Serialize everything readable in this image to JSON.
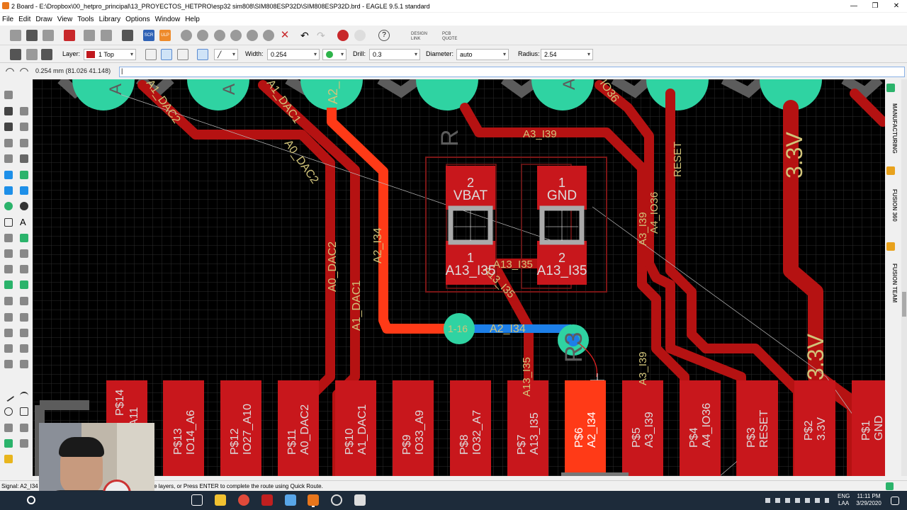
{
  "window": {
    "title": "2 Board - E:\\Dropbox\\00_hetpro_principal\\13_PROYECTOS_HETPRO\\esp32 sim808\\SIM808ESP32D\\SIM808ESP32D.brd - EAGLE 9.5.1 standard"
  },
  "menu": [
    "File",
    "Edit",
    "Draw",
    "View",
    "Tools",
    "Library",
    "Options",
    "Window",
    "Help"
  ],
  "toolbar": {
    "design_link": "DESIGN\nLINK",
    "pcb_quote": "PCB\nQUOTE",
    "scr": "SCR",
    "ulp": "ULP"
  },
  "params": {
    "layer_label": "Layer:",
    "layer_value": "1 Top",
    "layer_color": "#c0181d",
    "width_label": "Width:",
    "width_value": "0.254",
    "drill_label": "Drill:",
    "drill_value": "0.3",
    "diameter_label": "Diameter:",
    "diameter_value": "auto",
    "radius_label": "Radius:",
    "radius_value": "2.54"
  },
  "command": {
    "coords": "0.254 mm (81.026 41.148)",
    "value": "|"
  },
  "status": "Signal: A2_I34 ...ble-click ends wire), Press SPACE to change layers, or Press ENTER to complete the route using Quick Route.",
  "side_tabs": [
    "MANUFACTURING",
    "FUSION 360",
    "FUSION TEAM"
  ],
  "tray": {
    "lang1": "ENG",
    "lang2": "LAA",
    "time": "11:11 PM",
    "date": "3/29/2020"
  },
  "colors": {
    "copper": "#b51212",
    "pad": "#c8171c",
    "highlight": "#ff3a17",
    "route_blue": "#1d7fe8",
    "via": "#2fd3a2",
    "grid": "#2c2c2c",
    "text": "#d1c47a"
  },
  "board": {
    "top_labels": [
      "A",
      "A",
      "A2_",
      "A",
      "A1_DAC2",
      "A1_DAC1",
      "A0_DAC2",
      "IO36",
      "R",
      "A3_I39"
    ],
    "net_labels": [
      "A0_DAC2",
      "A1_DAC1",
      "A2_I34",
      "A13_I35",
      "A13_I35",
      "A3_I39",
      "A4_IO36",
      "RESET",
      "3.3V",
      "3.3V",
      "A3_I39",
      "A2_I34",
      "1-16",
      "A13_I35"
    ],
    "smd_labels": [
      "2",
      "VBAT",
      "1",
      "A13_I35",
      "1",
      "GND",
      "2",
      "A13_I35"
    ],
    "pads": [
      {
        "pin": "P$14",
        "net": "A11"
      },
      {
        "pin": "P$13",
        "net": "IO14_A6"
      },
      {
        "pin": "P$12",
        "net": "IO27_A10"
      },
      {
        "pin": "P$11",
        "net": "A0_DAC2"
      },
      {
        "pin": "P$10",
        "net": "A1_DAC1"
      },
      {
        "pin": "P$9",
        "net": "IO33_A9"
      },
      {
        "pin": "P$8",
        "net": "IO32_A7"
      },
      {
        "pin": "P$7",
        "net": "A13_I35"
      },
      {
        "pin": "P$6",
        "net": "A2_I34"
      },
      {
        "pin": "P$5",
        "net": "A3_I39"
      },
      {
        "pin": "P$4",
        "net": "A4_IO36"
      },
      {
        "pin": "P$3",
        "net": "RESET"
      },
      {
        "pin": "P$2",
        "net": "3.3V"
      },
      {
        "pin": "P$1",
        "net": "GND"
      }
    ],
    "comp_labels": [
      "R3"
    ]
  }
}
